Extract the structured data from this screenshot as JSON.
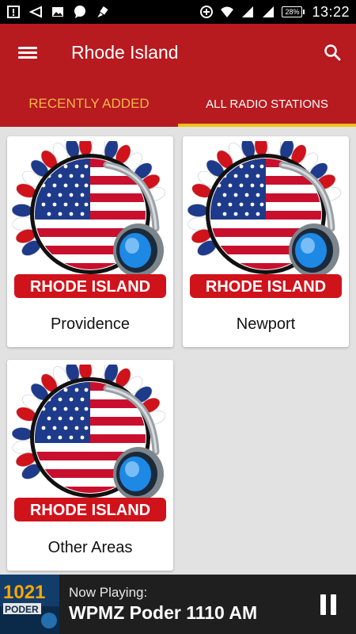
{
  "status_bar": {
    "time": "13:22",
    "battery": "28%",
    "icons": [
      "notification-icon",
      "back-icon",
      "image-icon",
      "chat-icon",
      "brush-icon",
      "data-saver-icon",
      "wifi-icon",
      "signal-icon",
      "signal-2-icon"
    ]
  },
  "app_bar": {
    "title": "Rhode Island",
    "menu_icon": "menu-icon",
    "search_icon": "search-icon",
    "color": "#b71a1f"
  },
  "tabs": [
    {
      "label": "RECENTLY ADDED",
      "active": false
    },
    {
      "label": "ALL RADIO STATIONS",
      "active": true
    }
  ],
  "cards": [
    {
      "label": "Providence",
      "banner": "RHODE ISLAND"
    },
    {
      "label": "Newport",
      "banner": "RHODE ISLAND"
    },
    {
      "label": "Other Areas",
      "banner": "RHODE ISLAND"
    }
  ],
  "player": {
    "now_playing": "Now Playing:",
    "station": "WPMZ Poder 1110 AM",
    "logo_text": "1021",
    "logo_sub": "PODER",
    "pause_icon": "pause-icon"
  }
}
